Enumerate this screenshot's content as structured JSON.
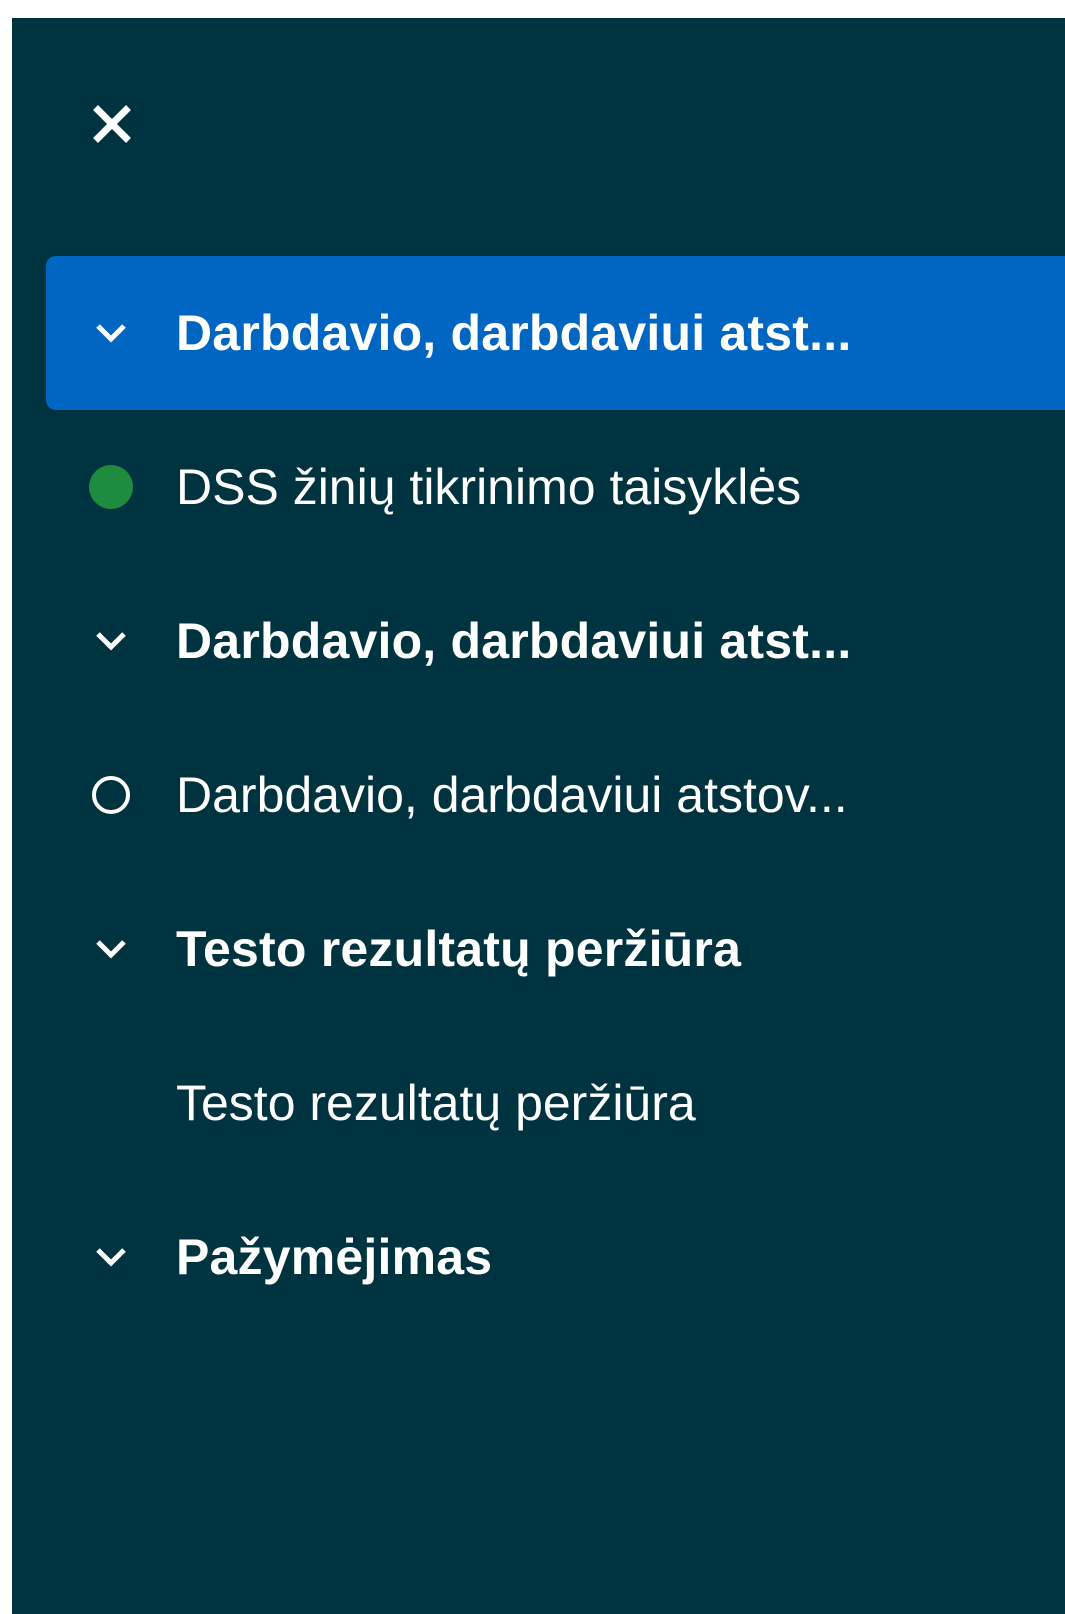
{
  "panel": {
    "close_icon": "close-icon",
    "items": [
      {
        "type": "section",
        "label": "Darbdavio, darbdaviui atst...",
        "icon": "chevron-down-icon",
        "active": true
      },
      {
        "type": "lesson",
        "label": "DSS žinių tikrinimo taisyklės",
        "icon": "status-complete-icon",
        "status_color": "#1f8b3f"
      },
      {
        "type": "section",
        "label": "Darbdavio, darbdaviui atst...",
        "icon": "chevron-down-icon"
      },
      {
        "type": "lesson",
        "label": "Darbdavio, darbdaviui atstov...",
        "icon": "status-incomplete-icon"
      },
      {
        "type": "section",
        "label": "Testo rezultatų peržiūra",
        "icon": "chevron-down-icon"
      },
      {
        "type": "lesson",
        "label": "Testo rezultatų peržiūra",
        "icon": ""
      },
      {
        "type": "section",
        "label": "Pažymėjimas",
        "icon": "chevron-down-icon"
      }
    ]
  },
  "colors": {
    "panel_bg": "#003340",
    "active_bg": "#0066c2",
    "complete": "#1f8b3f",
    "text": "#ffffff"
  }
}
